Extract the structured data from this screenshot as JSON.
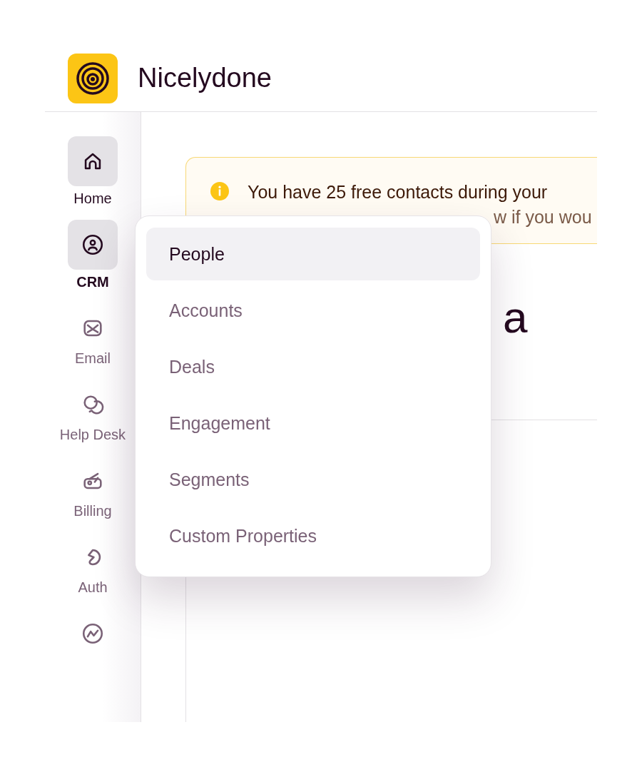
{
  "header": {
    "app_name": "Nicelydone"
  },
  "sidebar": {
    "items": [
      {
        "label": "Home",
        "kind": "home",
        "selected": false,
        "hovered": true
      },
      {
        "label": "CRM",
        "kind": "crm",
        "selected": true,
        "hovered": false
      },
      {
        "label": "Email",
        "kind": "email",
        "selected": false,
        "hovered": false
      },
      {
        "label": "Help Desk",
        "kind": "helpdesk",
        "selected": false,
        "hovered": false
      },
      {
        "label": "Billing",
        "kind": "billing",
        "selected": false,
        "hovered": false
      },
      {
        "label": "Auth",
        "kind": "auth",
        "selected": false,
        "hovered": false
      },
      {
        "kind": "analytics",
        "selected": false,
        "hovered": false
      }
    ]
  },
  "banner": {
    "line_1": "You have 25 free contacts during your",
    "line_2": "w if you wou"
  },
  "page_heading": "a",
  "menu": {
    "items": [
      {
        "label": "People",
        "selected": true
      },
      {
        "label": "Accounts",
        "selected": false
      },
      {
        "label": "Deals",
        "selected": false
      },
      {
        "label": "Engagement",
        "selected": false
      },
      {
        "label": "Segments",
        "selected": false
      },
      {
        "label": "Custom Properties",
        "selected": false
      }
    ]
  }
}
